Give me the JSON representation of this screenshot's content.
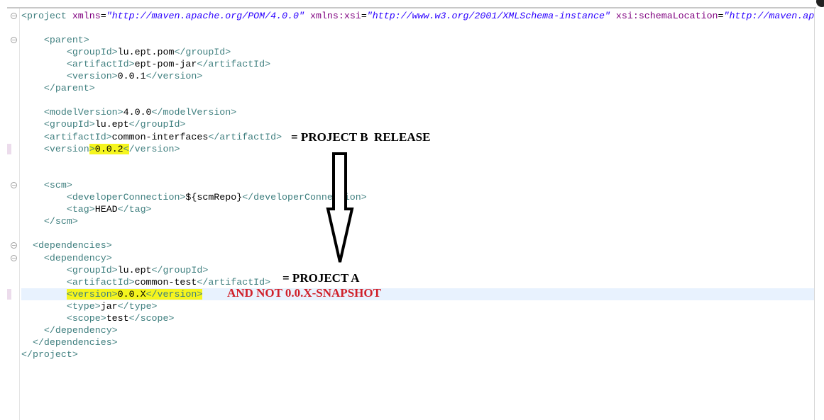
{
  "colors": {
    "tag": "#3f7f7f",
    "attr": "#7f007f",
    "value": "#2a00ff",
    "highlight": "#f5f51e",
    "current_line": "#e8f2fe",
    "note_black": "#000000",
    "note_red": "#d0202a"
  },
  "lines": [
    [
      {
        "k": "t",
        "s": "<project "
      },
      {
        "k": "a",
        "s": "xmlns"
      },
      {
        "k": "c",
        "s": "="
      },
      {
        "k": "v",
        "s": "\"http://maven.apache.org/POM/4.0.0\""
      },
      {
        "k": "c",
        "s": " "
      },
      {
        "k": "a",
        "s": "xmlns:xsi"
      },
      {
        "k": "c",
        "s": "="
      },
      {
        "k": "v",
        "s": "\"http://www.w3.org/2001/XMLSchema-instance\""
      },
      {
        "k": "c",
        "s": " "
      },
      {
        "k": "a",
        "s": "xsi:schemaLocation"
      },
      {
        "k": "c",
        "s": "="
      },
      {
        "k": "v",
        "s": "\"http://maven.ap"
      }
    ],
    [],
    [
      {
        "k": "t",
        "s": "    <parent>"
      }
    ],
    [
      {
        "k": "t",
        "s": "        <groupId>"
      },
      {
        "k": "c",
        "s": "lu.ept.pom"
      },
      {
        "k": "t",
        "s": "</groupId>"
      }
    ],
    [
      {
        "k": "t",
        "s": "        <artifactId>"
      },
      {
        "k": "c",
        "s": "ept-pom-jar"
      },
      {
        "k": "t",
        "s": "</artifactId>"
      }
    ],
    [
      {
        "k": "t",
        "s": "        <version>"
      },
      {
        "k": "c",
        "s": "0.0.1"
      },
      {
        "k": "t",
        "s": "</version>"
      }
    ],
    [
      {
        "k": "t",
        "s": "    </parent>"
      }
    ],
    [],
    [
      {
        "k": "t",
        "s": "    <modelVersion>"
      },
      {
        "k": "c",
        "s": "4.0.0"
      },
      {
        "k": "t",
        "s": "</modelVersion>"
      }
    ],
    [
      {
        "k": "t",
        "s": "    <groupId>"
      },
      {
        "k": "c",
        "s": "lu.ept"
      },
      {
        "k": "t",
        "s": "</groupId>"
      }
    ],
    [
      {
        "k": "t",
        "s": "    <artifactId>"
      },
      {
        "k": "c",
        "s": "common-interfaces"
      },
      {
        "k": "t",
        "s": "</artifactId>"
      }
    ],
    [
      {
        "k": "t",
        "s": "    <version"
      },
      {
        "k": "t hl",
        "s": ">"
      },
      {
        "k": "c hl",
        "s": "0.0.2"
      },
      {
        "k": "t hl",
        "s": "<"
      },
      {
        "k": "t",
        "s": "/version>"
      }
    ],
    [],
    [],
    [
      {
        "k": "t",
        "s": "    <scm>"
      }
    ],
    [
      {
        "k": "t",
        "s": "        <developerConnection>"
      },
      {
        "k": "c",
        "s": "${scmRepo}"
      },
      {
        "k": "t",
        "s": "</developerConnection>"
      }
    ],
    [
      {
        "k": "t",
        "s": "        <tag>"
      },
      {
        "k": "c",
        "s": "HEAD"
      },
      {
        "k": "t",
        "s": "</tag>"
      }
    ],
    [
      {
        "k": "t",
        "s": "    </scm>"
      }
    ],
    [],
    [
      {
        "k": "t",
        "s": "  <dependencies>"
      }
    ],
    [
      {
        "k": "t",
        "s": "    <dependency>"
      }
    ],
    [
      {
        "k": "t",
        "s": "        <groupId>"
      },
      {
        "k": "c",
        "s": "lu.ept"
      },
      {
        "k": "t",
        "s": "</groupId>"
      }
    ],
    [
      {
        "k": "t",
        "s": "        <artifactId>"
      },
      {
        "k": "c",
        "s": "common-test"
      },
      {
        "k": "t",
        "s": "</artifactId>"
      }
    ],
    [
      {
        "k": "t",
        "s": "        "
      },
      {
        "k": "t hl",
        "s": "<version>"
      },
      {
        "k": "c hl",
        "s": "0.0.X"
      },
      {
        "k": "t hl",
        "s": "</version>"
      }
    ],
    [
      {
        "k": "t",
        "s": "        <type>"
      },
      {
        "k": "c",
        "s": "jar"
      },
      {
        "k": "t",
        "s": "</type>"
      }
    ],
    [
      {
        "k": "t",
        "s": "        <scope>"
      },
      {
        "k": "c",
        "s": "test"
      },
      {
        "k": "t",
        "s": "</scope>"
      }
    ],
    [
      {
        "k": "t",
        "s": "    </dependency>"
      }
    ],
    [
      {
        "k": "t",
        "s": "  </dependencies>"
      }
    ],
    [
      {
        "k": "t",
        "s": "</project>"
      }
    ]
  ],
  "current_line_index": 23,
  "fold_lines": [
    0,
    2,
    14,
    19,
    20
  ],
  "marker_lines": [
    11,
    23
  ],
  "annotations": {
    "project_b": "= PROJECT B  RELEASE",
    "project_a": "= PROJECT A",
    "not_snapshot": "AND NOT 0.0.X-SNAPSHOT"
  },
  "icons": {
    "fold": "collapse-minus-icon",
    "arrow": "arrow-down-icon"
  }
}
